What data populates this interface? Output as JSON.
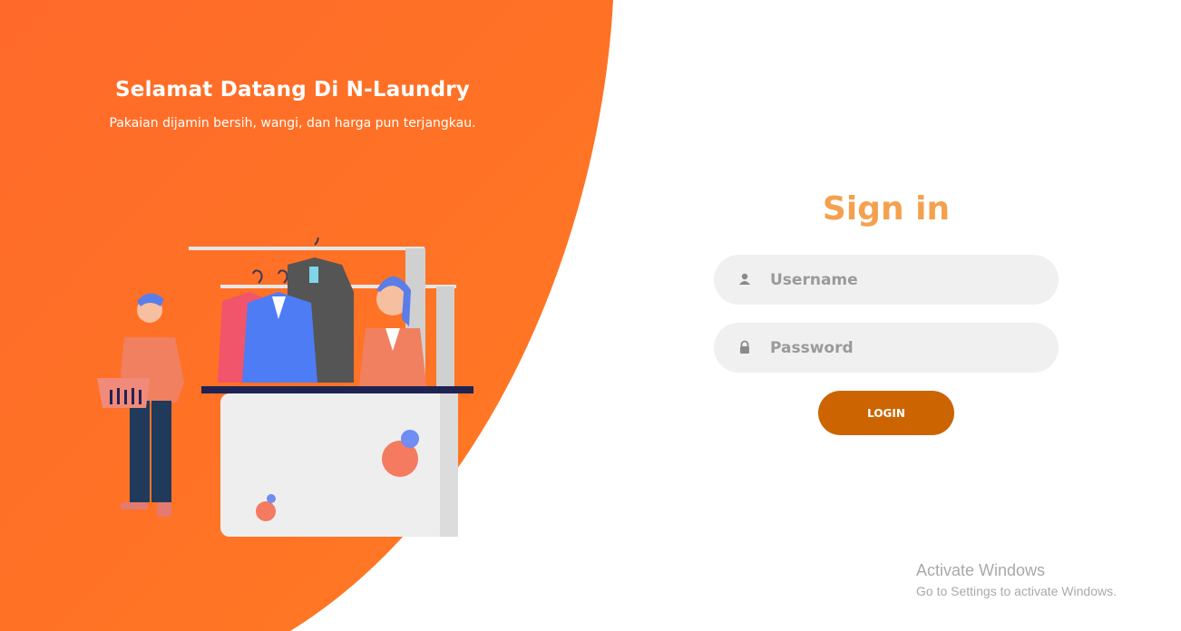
{
  "colors": {
    "accent": "#ff6d2a",
    "title": "#f4a14f",
    "button": "#cc6402",
    "field_bg": "#f0f0f0"
  },
  "hero": {
    "title": "Selamat Datang Di N-Laundry",
    "subtitle": "Pakaian dijamin bersih, wangi, dan harga pun terjangkau."
  },
  "signin": {
    "title": "Sign in",
    "username": {
      "placeholder": "Username",
      "value": "",
      "icon": "user-icon"
    },
    "password": {
      "placeholder": "Password",
      "value": "",
      "icon": "lock-icon"
    },
    "login_label": "LOGIN"
  },
  "watermark": {
    "title": "Activate Windows",
    "subtitle": "Go to Settings to activate Windows."
  }
}
